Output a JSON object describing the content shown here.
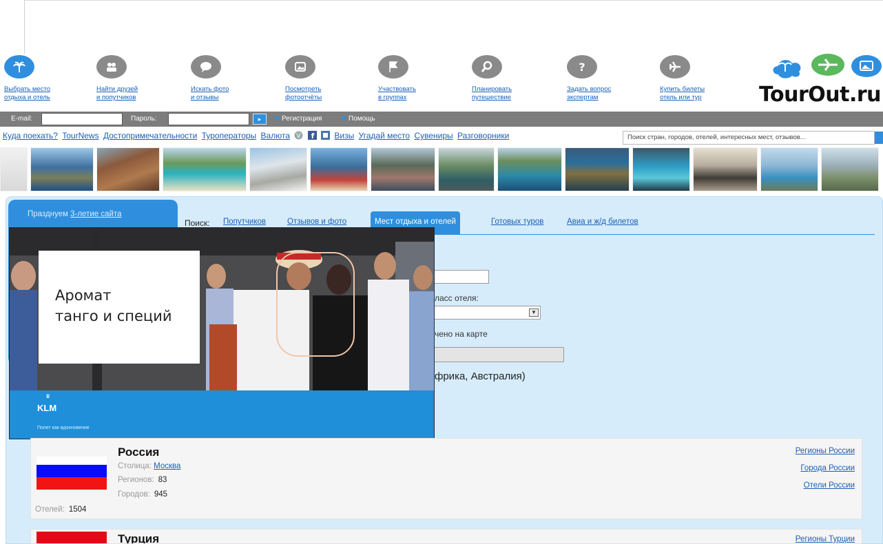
{
  "nav": {
    "items": [
      {
        "label_1": "Выбрать место",
        "label_2": "отдыха и отель",
        "icon": "palm-icon"
      },
      {
        "label_1": "Найти друзей",
        "label_2": "и попутчиков",
        "icon": "people-icon"
      },
      {
        "label_1": "Искать фото",
        "label_2": "и отзывы",
        "icon": "speech-bubble-icon"
      },
      {
        "label_1": "Посмотреть",
        "label_2": "фотоотчёты",
        "icon": "photo-icon"
      },
      {
        "label_1": "Участвовать",
        "label_2": "в группах",
        "icon": "flag-icon"
      },
      {
        "label_1": "Планировать",
        "label_2": "путешествие",
        "icon": "magnifier-icon"
      },
      {
        "label_1": "Задать вопрос",
        "label_2": "экспертам",
        "icon": "question-icon"
      },
      {
        "label_1": "Купить билеты",
        "label_2": "отель или тур",
        "icon": "airplane-icon"
      }
    ]
  },
  "logo": {
    "brand": "TourOut.ru"
  },
  "login": {
    "email_label": "E-mail:",
    "password_label": "Пароль:",
    "register": "Регистрация",
    "help": "Помощь"
  },
  "links": {
    "items": [
      "Куда поехать?",
      "TourNews",
      "Достопримечательности",
      "Туроператоры",
      "Валюта"
    ],
    "items2": [
      "Визы",
      "Угадай место",
      "Сувениры",
      "Разговорники"
    ],
    "search_placeholder": "Поиск стран, городов, отелей, интересных мест, отзывов..."
  },
  "promo": {
    "prefix": "Празднуем",
    "link": "3-летие сайта"
  },
  "search": {
    "label": "Поиск:",
    "tabs": [
      "Попутчиков",
      "Отзывов и фото",
      "Мест отдыха и отелей",
      "Готовых туров",
      "Авиа и ж/д билетов"
    ],
    "hotel_class_label": "ласс отеля:",
    "map_label": "чено на карте",
    "regions_text": "фрика, Австралия)"
  },
  "ad": {
    "title_1": "Аромат",
    "title_2": "танго и специй",
    "brand": "KLM",
    "slogan": "Полет как вдохновение"
  },
  "countries": [
    {
      "name": "Россия",
      "capital_label": "Столица:",
      "capital": "Москва",
      "regions_label": "Регионов:",
      "regions": "83",
      "cities_label": "Городов:",
      "cities": "945",
      "hotels_label": "Отелей:",
      "hotels": "1504",
      "links": [
        "Регионы России",
        "Города России",
        "Отели России"
      ]
    },
    {
      "name": "Турция",
      "links": [
        "Регионы Турции"
      ]
    }
  ],
  "colors": {
    "accent": "#2f8fde",
    "link": "#1a5fb4",
    "panel": "#d6ecfb"
  }
}
